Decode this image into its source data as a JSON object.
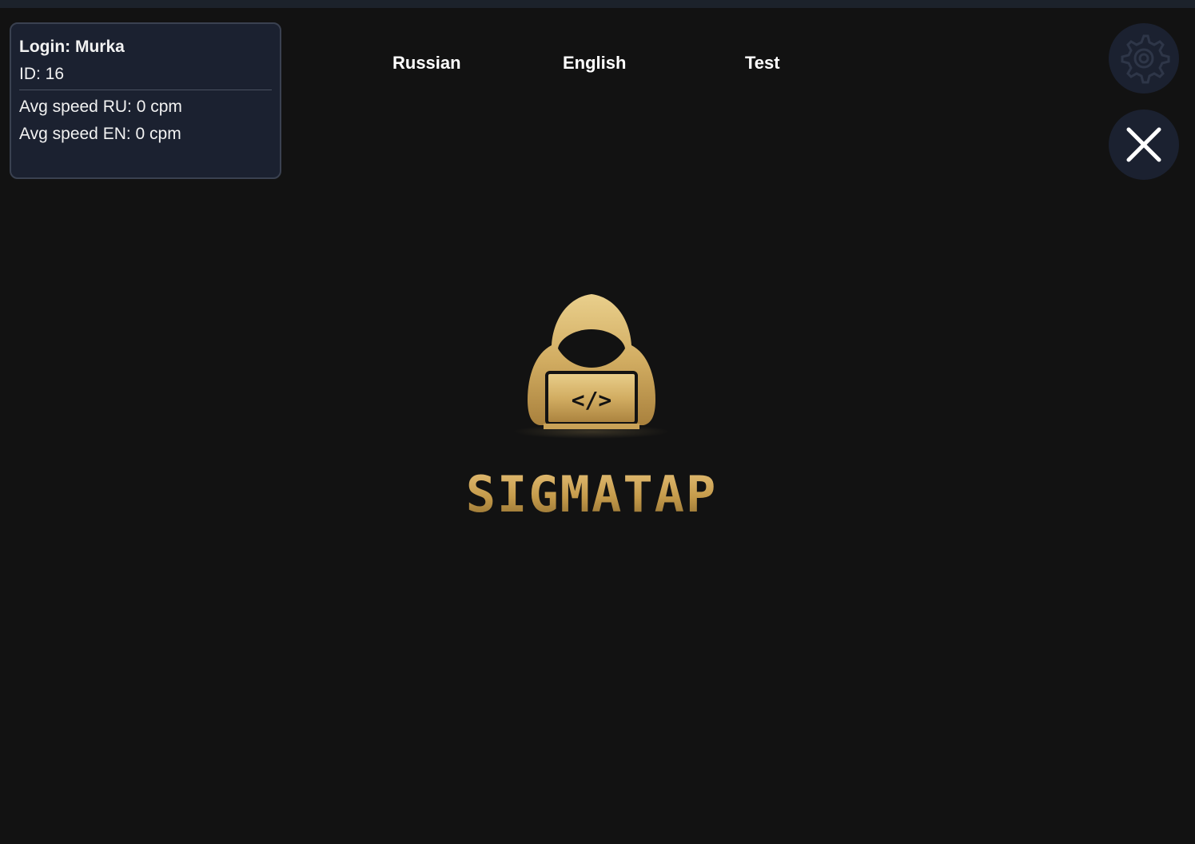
{
  "profile": {
    "login": "Login: Murka",
    "id": "ID: 16",
    "avg_speed_ru": "Avg speed RU: 0 cpm",
    "avg_speed_en": "Avg speed EN: 0 cpm"
  },
  "nav": {
    "items": [
      {
        "label": "Russian"
      },
      {
        "label": "English"
      },
      {
        "label": "Test"
      }
    ]
  },
  "controls": {
    "settings_icon": "gear-icon",
    "close_icon": "close-icon"
  },
  "logo": {
    "text": "SIGMATAP",
    "emblem_icon": "hooded-coder-icon",
    "code_symbol": "</>"
  },
  "colors": {
    "background": "#121212",
    "panel": "#1b2130",
    "gold": "#c9a257"
  }
}
